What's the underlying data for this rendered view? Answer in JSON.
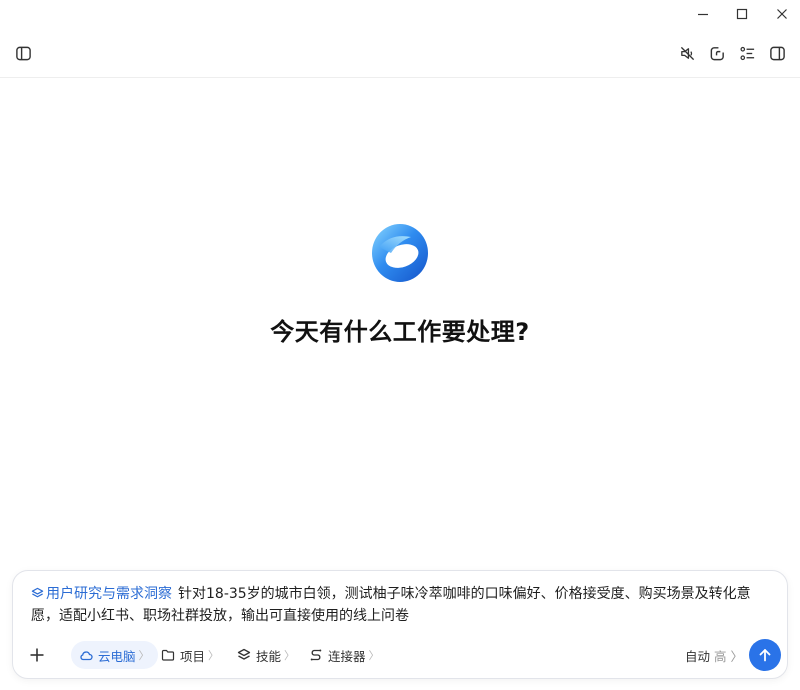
{
  "window_controls": {
    "minimize_icon": "minimize-icon",
    "maximize_icon": "maximize-icon",
    "close_icon": "close-icon"
  },
  "toolbar": {
    "left_icon": "sidebar-toggle-icon",
    "right_icons": [
      "mute-icon",
      "new-chat-icon",
      "task-list-icon",
      "right-panel-icon"
    ]
  },
  "hero": {
    "greeting": "今天有什么工作要处理?"
  },
  "composer": {
    "skill_tag": "用户研究与需求洞察",
    "prompt_text": "针对18-35岁的城市白领，测试柚子味冷萃咖啡的口味偏好、价格接受度、购买场景及转化意愿，适配小红书、职场社群投放，输出可直接使用的线上问卷",
    "chips": {
      "cloud": "云电脑",
      "project": "项目",
      "skills": "技能",
      "connectors": "连接器",
      "chevron": "〉"
    },
    "mode_label": "自动",
    "mode_level": "高"
  },
  "colors": {
    "accent": "#2a73e8",
    "skill_tag": "#2b6cd4",
    "chip_active_bg": "#eef3fd"
  }
}
